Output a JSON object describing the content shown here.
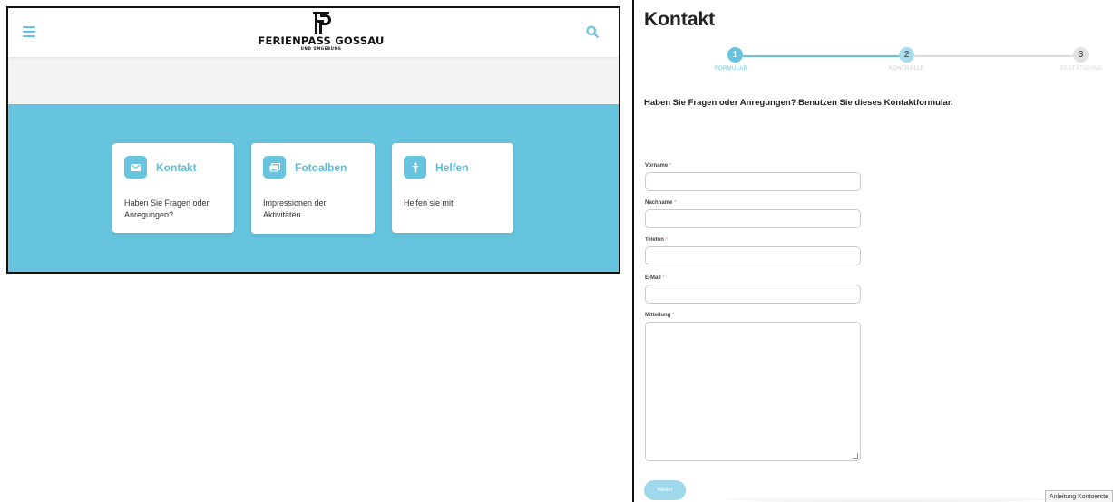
{
  "colors": {
    "accent": "#67c4df",
    "accent_text": "#5bbfdb",
    "grey_band": "#f3f3f3",
    "inactive": "#d8d8d8"
  },
  "left": {
    "logo_mark": "FP",
    "logo_text": "FERIENPASS GOSSAU",
    "logo_sub": "UND UMGEBUNG",
    "tiles": [
      {
        "icon": "envelope-icon",
        "title": "Kontakt",
        "text": "Haben Sie Fragen oder Anregungen?"
      },
      {
        "icon": "photos-icon",
        "title": "Fotoalben",
        "text": "Impressionen der Aktivitäten"
      },
      {
        "icon": "helper-icon",
        "title": "Helfen",
        "text": "Helfen sie mit"
      }
    ]
  },
  "right": {
    "title": "Kontakt",
    "steps": [
      {
        "number": "1",
        "label": "FORMULAR",
        "active": true
      },
      {
        "number": "2",
        "label": "KONTROLLE",
        "active": false
      },
      {
        "number": "3",
        "label": "BESTÄTIGUNG",
        "active": false
      }
    ],
    "intro": "Haben Sie Fragen oder Anregungen? Benutzen Sie dieses Kontaktformular.",
    "required_marker": "*",
    "fields": [
      {
        "label": "Vorname",
        "value": ""
      },
      {
        "label": "Nachname",
        "value": ""
      },
      {
        "label": "Telefon",
        "value": ""
      },
      {
        "label": "E-Mail",
        "value": ""
      }
    ],
    "message_label": "Mitteilung",
    "submit_label": "Weiter",
    "help_tab": "Anleitung Kontoerste"
  }
}
